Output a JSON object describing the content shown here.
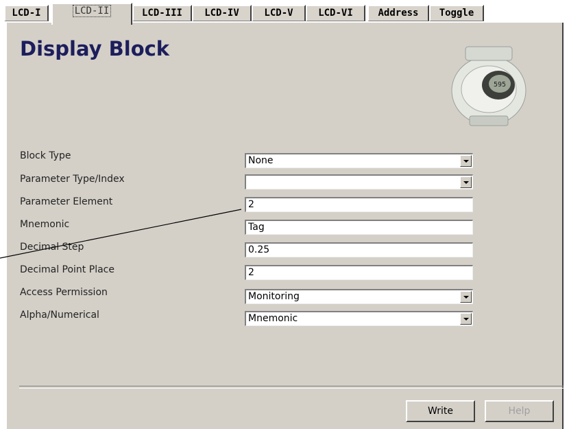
{
  "tabs": [
    {
      "label": "LCD-I"
    },
    {
      "label": "LCD-II"
    },
    {
      "label": "LCD-III"
    },
    {
      "label": "LCD-IV"
    },
    {
      "label": "LCD-V"
    },
    {
      "label": "LCD-VI"
    },
    {
      "label": "Address"
    },
    {
      "label": "Toggle"
    }
  ],
  "active_tab": "LCD-II",
  "page_title": "Display Block",
  "device_display_text": "595",
  "fields": [
    {
      "label": "Block Type",
      "value": "None",
      "type": "dropdown"
    },
    {
      "label": "Parameter Type/Index",
      "value": "",
      "type": "dropdown"
    },
    {
      "label": "Parameter Element",
      "value": "2",
      "type": "text"
    },
    {
      "label": "Mnemonic",
      "value": "Tag",
      "type": "text"
    },
    {
      "label": "Decimal Step",
      "value": "0.25",
      "type": "text"
    },
    {
      "label": "Decimal Point Place",
      "value": "2",
      "type": "text"
    },
    {
      "label": "Access Permission",
      "value": "Monitoring",
      "type": "dropdown"
    },
    {
      "label": "Alpha/Numerical",
      "value": "Mnemonic",
      "type": "dropdown"
    }
  ],
  "buttons": {
    "write": "Write",
    "help": "Help"
  },
  "colors": {
    "panel": "#d4d0c8",
    "title": "#1c1e5c"
  }
}
